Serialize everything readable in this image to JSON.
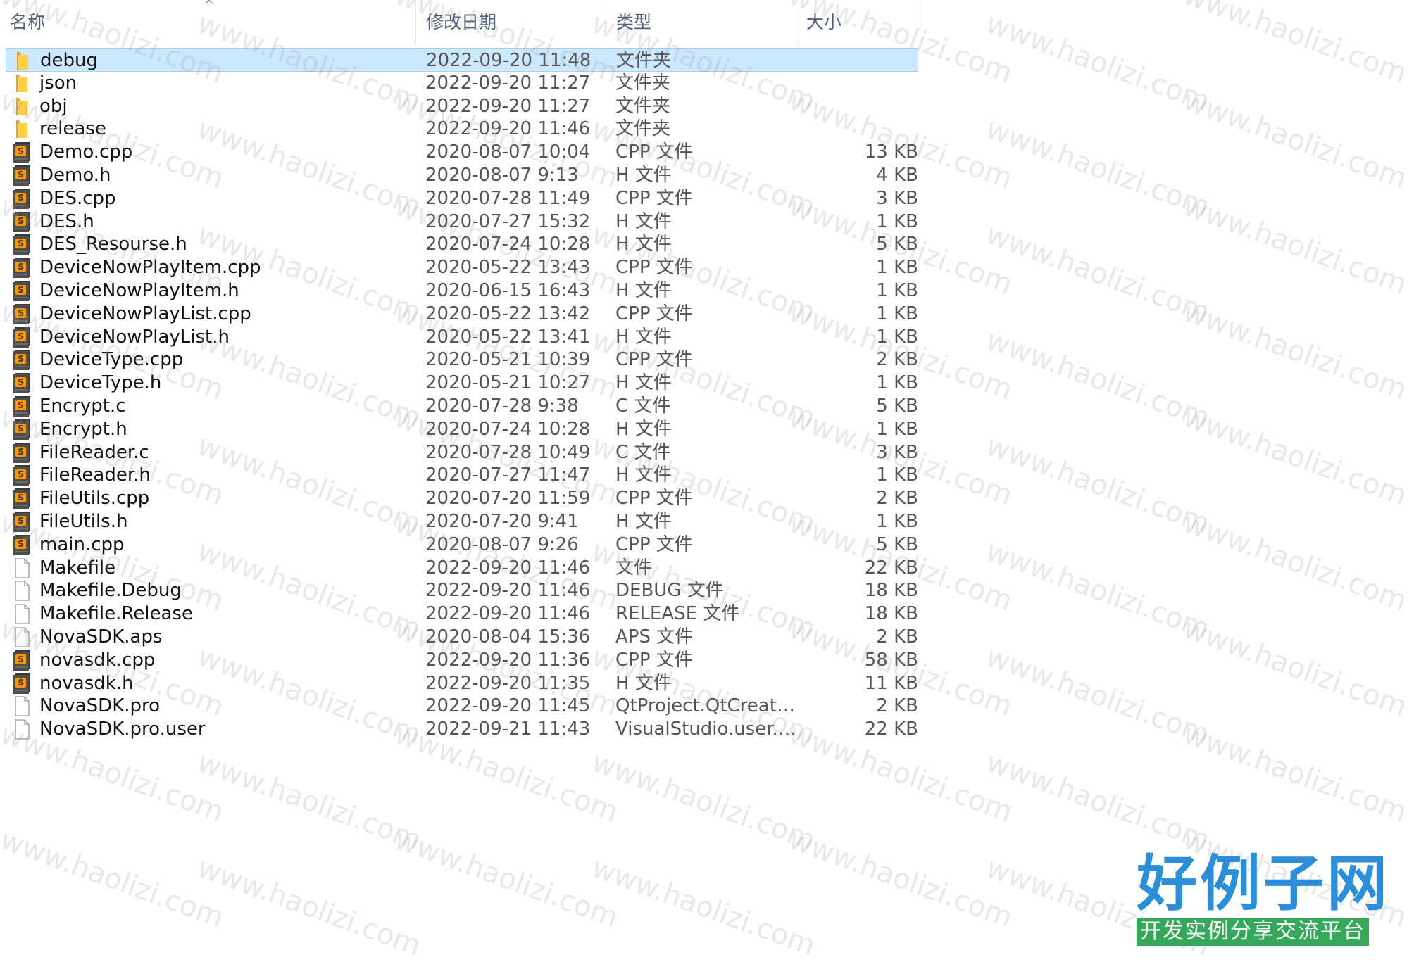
{
  "header": {
    "name": "名称",
    "date": "修改日期",
    "type": "类型",
    "size": "大小"
  },
  "files": [
    {
      "name": "debug",
      "date": "2022-09-20 11:48",
      "type": "文件夹",
      "size": "",
      "icon": "folder-icon",
      "selected": true
    },
    {
      "name": "json",
      "date": "2022-09-20 11:27",
      "type": "文件夹",
      "size": "",
      "icon": "folder-icon"
    },
    {
      "name": "obj",
      "date": "2022-09-20 11:27",
      "type": "文件夹",
      "size": "",
      "icon": "folder-icon"
    },
    {
      "name": "release",
      "date": "2022-09-20 11:46",
      "type": "文件夹",
      "size": "",
      "icon": "folder-icon"
    },
    {
      "name": "Demo.cpp",
      "date": "2020-08-07 10:04",
      "type": "CPP 文件",
      "size": "13 KB",
      "icon": "sublime-file-icon"
    },
    {
      "name": "Demo.h",
      "date": "2020-08-07 9:13",
      "type": "H 文件",
      "size": "4 KB",
      "icon": "sublime-file-icon"
    },
    {
      "name": "DES.cpp",
      "date": "2020-07-28 11:49",
      "type": "CPP 文件",
      "size": "3 KB",
      "icon": "sublime-file-icon"
    },
    {
      "name": "DES.h",
      "date": "2020-07-27 15:32",
      "type": "H 文件",
      "size": "1 KB",
      "icon": "sublime-file-icon"
    },
    {
      "name": "DES_Resourse.h",
      "date": "2020-07-24 10:28",
      "type": "H 文件",
      "size": "5 KB",
      "icon": "sublime-file-icon"
    },
    {
      "name": "DeviceNowPlayItem.cpp",
      "date": "2020-05-22 13:43",
      "type": "CPP 文件",
      "size": "1 KB",
      "icon": "sublime-file-icon"
    },
    {
      "name": "DeviceNowPlayItem.h",
      "date": "2020-06-15 16:43",
      "type": "H 文件",
      "size": "1 KB",
      "icon": "sublime-file-icon"
    },
    {
      "name": "DeviceNowPlayList.cpp",
      "date": "2020-05-22 13:42",
      "type": "CPP 文件",
      "size": "1 KB",
      "icon": "sublime-file-icon"
    },
    {
      "name": "DeviceNowPlayList.h",
      "date": "2020-05-22 13:41",
      "type": "H 文件",
      "size": "1 KB",
      "icon": "sublime-file-icon"
    },
    {
      "name": "DeviceType.cpp",
      "date": "2020-05-21 10:39",
      "type": "CPP 文件",
      "size": "2 KB",
      "icon": "sublime-file-icon"
    },
    {
      "name": "DeviceType.h",
      "date": "2020-05-21 10:27",
      "type": "H 文件",
      "size": "1 KB",
      "icon": "sublime-file-icon"
    },
    {
      "name": "Encrypt.c",
      "date": "2020-07-28 9:38",
      "type": "C 文件",
      "size": "5 KB",
      "icon": "sublime-file-icon"
    },
    {
      "name": "Encrypt.h",
      "date": "2020-07-24 10:28",
      "type": "H 文件",
      "size": "1 KB",
      "icon": "sublime-file-icon"
    },
    {
      "name": "FileReader.c",
      "date": "2020-07-28 10:49",
      "type": "C 文件",
      "size": "3 KB",
      "icon": "sublime-file-icon"
    },
    {
      "name": "FileReader.h",
      "date": "2020-07-27 11:47",
      "type": "H 文件",
      "size": "1 KB",
      "icon": "sublime-file-icon"
    },
    {
      "name": "FileUtils.cpp",
      "date": "2020-07-20 11:59",
      "type": "CPP 文件",
      "size": "2 KB",
      "icon": "sublime-file-icon"
    },
    {
      "name": "FileUtils.h",
      "date": "2020-07-20 9:41",
      "type": "H 文件",
      "size": "1 KB",
      "icon": "sublime-file-icon"
    },
    {
      "name": "main.cpp",
      "date": "2020-08-07 9:26",
      "type": "CPP 文件",
      "size": "5 KB",
      "icon": "sublime-file-icon"
    },
    {
      "name": "Makefile",
      "date": "2022-09-20 11:46",
      "type": "文件",
      "size": "22 KB",
      "icon": "blank-file-icon"
    },
    {
      "name": "Makefile.Debug",
      "date": "2022-09-20 11:46",
      "type": "DEBUG 文件",
      "size": "18 KB",
      "icon": "blank-file-icon"
    },
    {
      "name": "Makefile.Release",
      "date": "2022-09-20 11:46",
      "type": "RELEASE 文件",
      "size": "18 KB",
      "icon": "blank-file-icon"
    },
    {
      "name": "NovaSDK.aps",
      "date": "2020-08-04 15:36",
      "type": "APS 文件",
      "size": "2 KB",
      "icon": "blank-file-icon"
    },
    {
      "name": "novasdk.cpp",
      "date": "2022-09-20 11:36",
      "type": "CPP 文件",
      "size": "58 KB",
      "icon": "sublime-file-icon"
    },
    {
      "name": "novasdk.h",
      "date": "2022-09-20 11:35",
      "type": "H 文件",
      "size": "11 KB",
      "icon": "sublime-file-icon"
    },
    {
      "name": "NovaSDK.pro",
      "date": "2022-09-20 11:45",
      "type": "QtProject.QtCreato...",
      "size": "2 KB",
      "icon": "blank-file-icon"
    },
    {
      "name": "NovaSDK.pro.user",
      "date": "2022-09-21 11:43",
      "type": "VisualStudio.user.a...",
      "size": "22 KB",
      "icon": "blank-file-icon"
    }
  ],
  "watermark": "www.haolizi.com",
  "brand": {
    "title": "好例子网",
    "subtitle": "开发实例分享交流平台"
  }
}
